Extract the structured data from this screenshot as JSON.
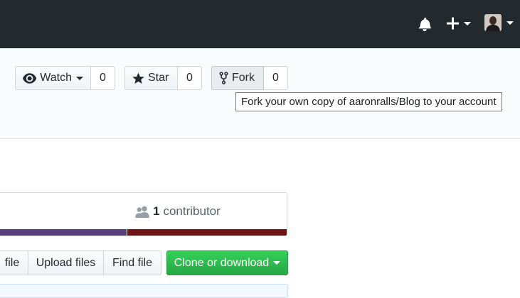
{
  "header": {
    "notifications_icon": "bell-icon",
    "create_icon": "plus-icon",
    "profile_icon": "avatar"
  },
  "repo_actions": {
    "watch": {
      "label": "Watch",
      "count": "0",
      "icon": "eye-icon"
    },
    "star": {
      "label": "Star",
      "count": "0",
      "icon": "star-icon"
    },
    "fork": {
      "label": "Fork",
      "count": "0",
      "icon": "repo-forked-icon"
    }
  },
  "tooltip": {
    "text": "Fork your own copy of aaronralls/Blog to your account"
  },
  "summary": {
    "contributors_count": "1",
    "contributors_label": "contributor",
    "language_colors": [
      "#563d7c",
      "#701516"
    ],
    "language_shares": [
      0.45,
      0.55
    ]
  },
  "file_actions": {
    "create_label": "file",
    "upload_label": "Upload files",
    "find_label": "Find file",
    "clone_label": "Clone or download"
  },
  "colors": {
    "header_bg": "#24292e",
    "clone_green": "#28a745"
  }
}
